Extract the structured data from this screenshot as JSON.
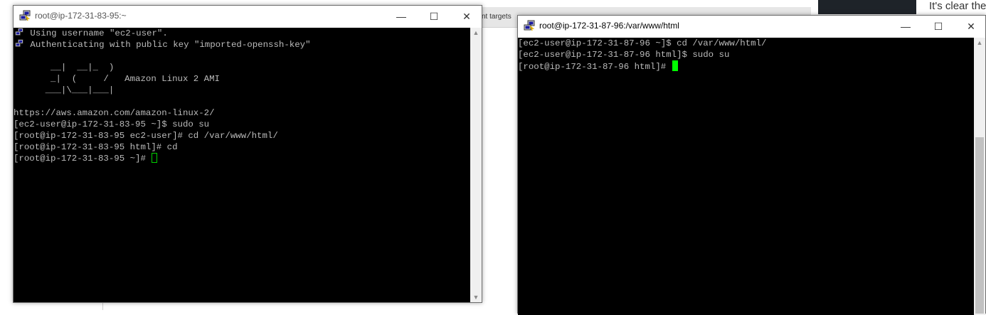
{
  "background": {
    "tab_text": "nt targets",
    "right_text": "It's clear the"
  },
  "window1": {
    "title": "root@ip-172-31-83-95:~",
    "title_color": "#555555",
    "lines": [
      " Using username \"ec2-user\".",
      " Authenticating with public key \"imported-openssh-key\"",
      "",
      "       __|  __|_  )",
      "       _|  (     /   Amazon Linux 2 AMI",
      "      ___|\\___|___|",
      "",
      "https://aws.amazon.com/amazon-linux-2/",
      "[ec2-user@ip-172-31-83-95 ~]$ sudo su",
      "[root@ip-172-31-83-95 ec2-user]# cd /var/www/html/",
      "[root@ip-172-31-83-95 html]# cd",
      "[root@ip-172-31-83-95 ~]# "
    ]
  },
  "window2": {
    "title": "root@ip-172-31-87-96:/var/www/html",
    "title_color": "#000000",
    "lines": [
      "[ec2-user@ip-172-31-87-96 ~]$ cd /var/www/html/",
      "[ec2-user@ip-172-31-87-96 html]$ sudo su",
      "[root@ip-172-31-87-96 html]# "
    ]
  },
  "controls": {
    "minimize": "—",
    "maximize": "☐",
    "close": "✕"
  },
  "icons": {
    "terminal": "putty-icon",
    "scroll_up": "▲",
    "scroll_down": "▼"
  },
  "colors": {
    "terminal_bg": "#000000",
    "terminal_fg": "#bbbbbb",
    "cursor": "#00ff00"
  }
}
